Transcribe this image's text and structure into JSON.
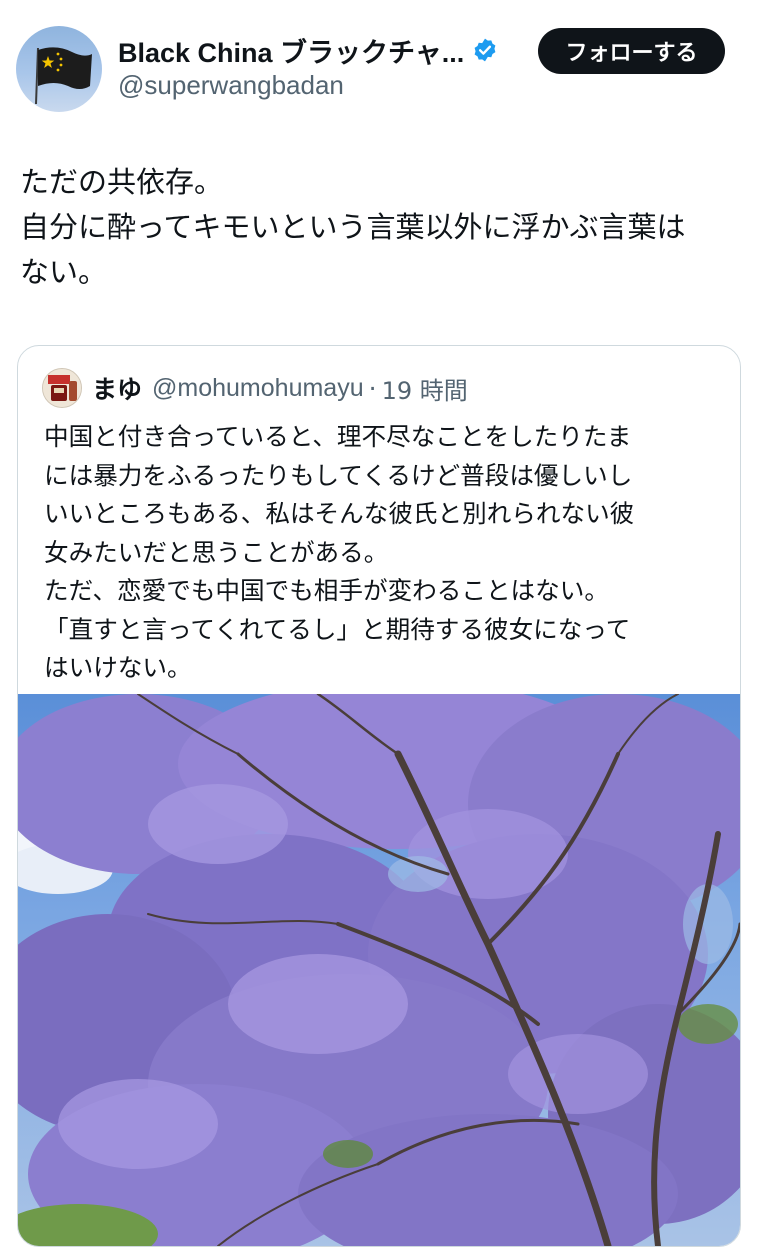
{
  "header": {
    "display_name": "Black China ブラックチャ...",
    "handle": "@superwangbadan",
    "follow_label": "フォローする",
    "avatar_icon": "flag-avatar-icon",
    "verified_icon": "verified-badge-icon",
    "verified_color": "#1d9bf0"
  },
  "tweet": {
    "lines": [
      "ただの共依存。",
      "自分に酔ってキモいという言葉以外に浮かぶ言葉は",
      "ない。"
    ]
  },
  "quote": {
    "name": "まゆ",
    "handle": "@mohumohumayu",
    "separator": "·",
    "time": "19 時間",
    "lines": [
      "中国と付き合っていると、理不尽なことをしたりたま",
      "には暴力をふるったりもしてくるけど普段は優しいし",
      "いいところもある、私はそんな彼氏と別れられない彼",
      "女みたいだと思うことがある。",
      "ただ、恋愛でも中国でも相手が変わることはない。",
      "「直すと言ってくれてるし」と期待する彼女になって",
      "はいけない。"
    ]
  },
  "colors": {
    "text": "#0f1419",
    "secondary": "#536471",
    "border": "#cfd9de",
    "button": "#0f1419"
  }
}
